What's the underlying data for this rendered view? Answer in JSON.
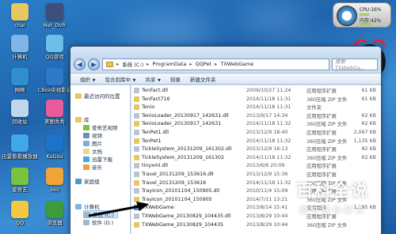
{
  "desktop": {
    "icons": [
      {
        "label": "chai",
        "color": "#e9c760"
      },
      {
        "label": "Net_DVR",
        "color": "#3d4f7a"
      },
      {
        "label": "计算机",
        "color": "#7fb6e8"
      },
      {
        "label": "QQ游戏",
        "color": "#6cc0e8"
      },
      {
        "label": "网络",
        "color": "#2f8fd1"
      },
      {
        "label": "CBox央视影音",
        "color": "#2e79c8"
      },
      {
        "label": "回收站",
        "color": "#bfd7ea"
      },
      {
        "label": "美图秀秀",
        "color": "#e85c9b"
      },
      {
        "label": "迅雷看看播放器",
        "color": "#3fa7ea"
      },
      {
        "label": "KuGou",
        "color": "#1c73c8"
      },
      {
        "label": "爱奇艺",
        "color": "#79c43f"
      },
      {
        "label": "360",
        "color": "#f1a43a"
      },
      {
        "label": "QQ",
        "color": "#f4c840"
      },
      {
        "label": "浏览器",
        "color": "#3e9a3e"
      }
    ]
  },
  "cpu_widget": {
    "cpu_label": "CPU:16%",
    "mem_label": "内存:42%",
    "cpu_percent": 16,
    "mem_percent": 42
  },
  "explorer": {
    "address_parts": [
      "系统 (C:)",
      "ProgramData",
      "QQPet",
      "TXWebGame"
    ],
    "search_placeholder": "搜索 TXWebGa...",
    "toolbar": {
      "organize": "组织",
      "include": "包含到库中",
      "share": "共享",
      "burn": "刻录",
      "new_folder": "新建文件夹"
    },
    "nav": [
      {
        "label": "最近访问的位置",
        "color": "#e9c760"
      },
      {
        "label": "库",
        "color": "#e9c760"
      },
      {
        "label": "爱奇艺视频",
        "color": "#79c43f"
      },
      {
        "label": "视频",
        "color": "#6d8fc0"
      },
      {
        "label": "图片",
        "color": "#7ab0d8"
      },
      {
        "label": "文档",
        "color": "#e9d78a"
      },
      {
        "label": "迅雷下载",
        "color": "#3fa7ea"
      },
      {
        "label": "音乐",
        "color": "#f0a13b"
      },
      {
        "label": "家庭组",
        "color": "#4b9ad6"
      },
      {
        "label": "计算机",
        "color": "#7fb6e8"
      },
      {
        "label": "系统 (C:)",
        "color": "#9fb8d2"
      },
      {
        "label": "软件 (D:)",
        "color": "#9fb8d2"
      }
    ],
    "files": [
      {
        "name": "TenFact.dll",
        "date": "2009/10/27 11:24",
        "type": "应用程序扩展",
        "size": "61 KB",
        "color": "#b8c4d4"
      },
      {
        "name": "TenFact716",
        "date": "2014/11/18 11:31",
        "type": "360压缩 ZIP 文件",
        "size": "61 KB",
        "color": "#e9c760"
      },
      {
        "name": "Tenio",
        "date": "2014/11/18 11:31",
        "type": "文件夹",
        "size": "",
        "color": "#e9c760"
      },
      {
        "name": "TenioLoader_20130917_142631.dll",
        "date": "2013/9/17 14:34",
        "type": "应用程序扩展",
        "size": "62 KB",
        "color": "#b8c4d4"
      },
      {
        "name": "TenioLoader_20130917_142631",
        "date": "2014/11/18 11:32",
        "type": "360压缩 ZIP 文件",
        "size": "62 KB",
        "color": "#e9c760"
      },
      {
        "name": "TenPet1.dll",
        "date": "2013/12/9 18:40",
        "type": "应用程序扩展",
        "size": "2,067 KB",
        "color": "#b8c4d4"
      },
      {
        "name": "TenPet1",
        "date": "2014/11/18 11:32",
        "type": "360压缩 ZIP 文件",
        "size": "1,135 KB",
        "color": "#e9c760"
      },
      {
        "name": "TickleSystem_20131209_161302.dll",
        "date": "2013/12/9 16:13",
        "type": "应用程序扩展",
        "size": "82 KB",
        "color": "#b8c4d4"
      },
      {
        "name": "TickleSystem_20131209_161302",
        "date": "2014/11/18 11:32",
        "type": "360压缩 ZIP 文件",
        "size": "62 KB",
        "color": "#e9c760"
      },
      {
        "name": "tinyxml.dll",
        "date": "2013/6/6 20:09",
        "type": "应用程序扩展",
        "size": "",
        "color": "#b8c4d4"
      },
      {
        "name": "Travel_20131209_153616.dll",
        "date": "2013/12/9 15:36",
        "type": "应用程序扩展",
        "size": "",
        "color": "#b8c4d4"
      },
      {
        "name": "Travel_20131209_153616",
        "date": "2014/11/18 11:32",
        "type": "360压缩 ZIP 文件",
        "size": "",
        "color": "#e9c760"
      },
      {
        "name": "TrayIcon_20101104_150905.dll",
        "date": "2010/11/4 15:09",
        "type": "应用程序扩展",
        "size": "",
        "color": "#b8c4d4"
      },
      {
        "name": "TrayIcon_20101104_150905",
        "date": "2014/7/11 13:21",
        "type": "360压缩 ZIP 文件",
        "size": "",
        "color": "#e9c760"
      },
      {
        "name": "TXWebGame",
        "date": "2013/8/14 15:41",
        "type": "应用程序",
        "size": "1,195 KB",
        "color": "#4a8ad0"
      },
      {
        "name": "TXWebGame_20130829_104435.dll",
        "date": "2013/8/29 10:44",
        "type": "应用程序扩展",
        "size": "",
        "color": "#b8c4d4"
      },
      {
        "name": "TXWebGame_20130829_104435",
        "date": "2013/8/29 10:44",
        "type": "360压缩 ZIP 文件",
        "size": "",
        "color": "#e9c760"
      }
    ]
  },
  "watermark": {
    "big": "百科全说",
    "small": "助你轻松解决"
  }
}
